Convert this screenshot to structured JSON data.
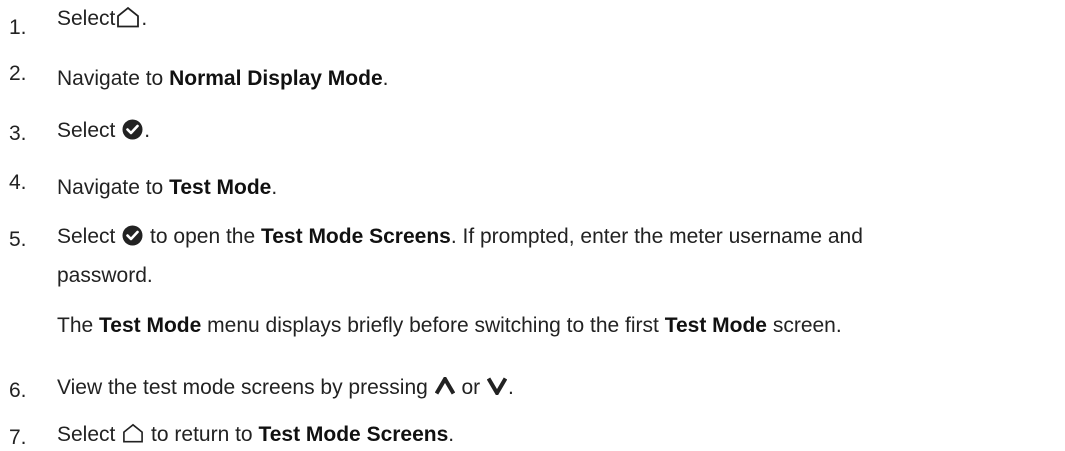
{
  "steps": [
    {
      "number": "1.",
      "t1": "Select",
      "t2": "."
    },
    {
      "number": "2.",
      "t1": "Navigate to ",
      "b1": "Normal Display Mode",
      "t2": "."
    },
    {
      "number": "3.",
      "t1": "Select",
      "t2": "."
    },
    {
      "number": "4.",
      "t1": "Navigate to ",
      "b1": "Test Mode",
      "t2": "."
    },
    {
      "number": "5.",
      "t1": "Select",
      "t2": " to open the ",
      "b1": "Test Mode Screens",
      "t3": ". If prompted, enter the meter username and",
      "line2": "password.",
      "note": {
        "t1": "The ",
        "b1": "Test Mode",
        "t2": " menu displays briefly before switching to the first ",
        "b2": "Test Mode",
        "t3": " screen."
      }
    },
    {
      "number": "6.",
      "t1": "View the test mode screens by pressing ",
      "t2": " or ",
      "t3": "."
    },
    {
      "number": "7.",
      "t1": "Select",
      "t2": " to return to ",
      "b1": "Test Mode Screens",
      "t3": "."
    }
  ],
  "icons": {
    "home": "home-icon",
    "check": "check-circle-icon",
    "up": "up-arrow-icon",
    "down": "down-arrow-icon"
  }
}
